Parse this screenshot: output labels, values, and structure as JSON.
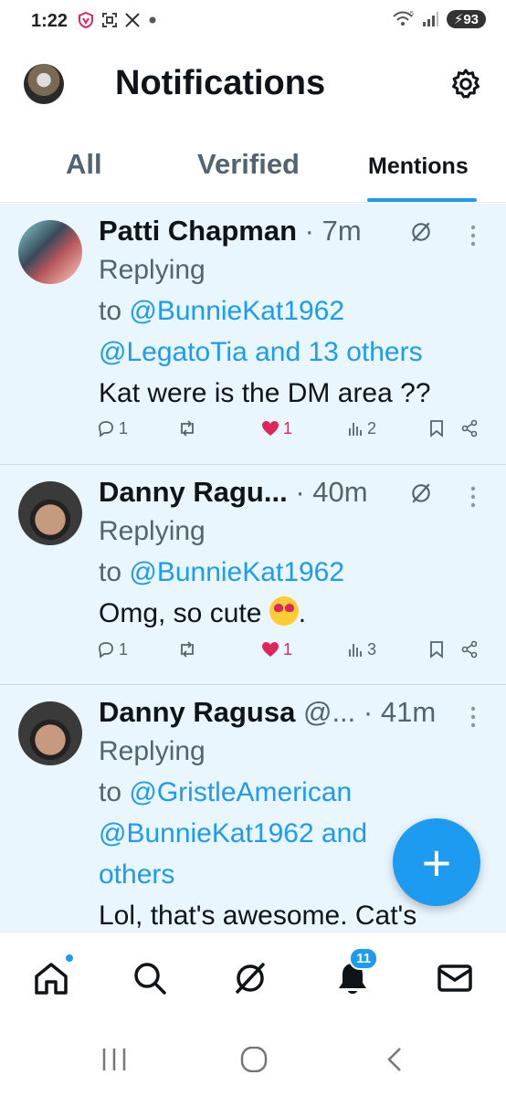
{
  "status_bar": {
    "time": "1:22",
    "left_icons": [
      "vpn-shield-icon",
      "screenshot-icon",
      "x-icon",
      "dot-icon"
    ],
    "battery": "93",
    "wifi_label": "5"
  },
  "header": {
    "title": "Notifications"
  },
  "tabs": [
    {
      "label": "All"
    },
    {
      "label": "Verified"
    },
    {
      "label": "Mentions",
      "active": true
    }
  ],
  "posts": [
    {
      "name": "Patti Chapman",
      "handle": "",
      "time": "7m",
      "replying": "Replying",
      "to": "to",
      "mentions_1": "@BunnieKat1962",
      "mentions_2": "@LegatoTia and 13 others",
      "text": "Kat were is the DM area ??",
      "replies": "1",
      "reposts": "",
      "likes": "1",
      "views": "2"
    },
    {
      "name": "Danny Ragu...",
      "handle": "",
      "time": "40m",
      "replying": "Replying",
      "to": "to",
      "mentions_1": "@BunnieKat1962",
      "text": "Omg, so cute",
      "text_end": ".",
      "replies": "1",
      "reposts": "",
      "likes": "1",
      "views": "3"
    },
    {
      "name": "Danny Ragusa",
      "handle": "@...",
      "time": "41m",
      "replying": "Replying",
      "to": "to",
      "mentions_1": "@GristleAmerican",
      "mentions_2": "@BunnieKat1962 and",
      "mentions_3": "others",
      "text": "Lol, that's awesome. Cat's"
    }
  ],
  "fab": {
    "label": "+"
  },
  "bottom_nav": {
    "notification_count": "11"
  },
  "colors": {
    "accent": "#1d9bf0",
    "like": "#e0245e",
    "unread_bg": "#eaf6fd"
  }
}
